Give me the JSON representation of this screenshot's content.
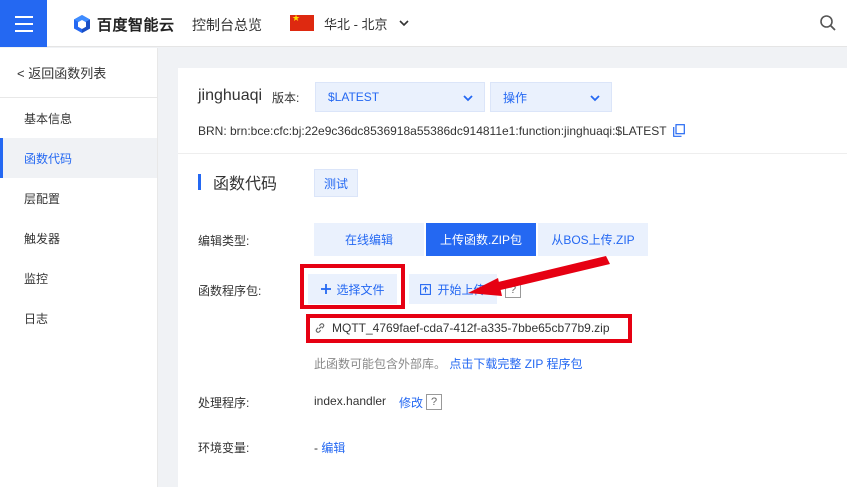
{
  "topbar": {
    "brand": "百度智能云",
    "console_link": "控制台总览",
    "region": "华北 - 北京",
    "icons": [
      "menu-icon",
      "baidu-cloud-logo",
      "china-flag-icon",
      "chevron-down-icon",
      "search-icon"
    ]
  },
  "sidebar": {
    "back": "< 返回函数列表",
    "items": [
      {
        "label": "基本信息"
      },
      {
        "label": "函数代码",
        "active": true
      },
      {
        "label": "层配置"
      },
      {
        "label": "触发器"
      },
      {
        "label": "监控"
      },
      {
        "label": "日志"
      }
    ]
  },
  "main": {
    "function_name": "jinghuaqi",
    "version_label": "版本:",
    "version_value": "$LATEST",
    "action_value": "操作",
    "brn": "BRN:  brn:bce:cfc:bj:22e9c36dc8536918a55386dc914811e1:function:jinghuaqi:$LATEST",
    "section_title": "函数代码",
    "test_button": "测试",
    "edit_type_label": "编辑类型:",
    "edit_types": [
      "在线编辑",
      "上传函数.ZIP包",
      "从BOS上传.ZIP"
    ],
    "edit_type_selected": "上传函数.ZIP包",
    "package_label": "函数程序包:",
    "choose_file": "选择文件",
    "start_upload": "开始上传",
    "help": "?",
    "file_name": "MQTT_4769faef-cda7-412f-a335-7bbe65cb77b9.zip",
    "note_text": "此函数可能包含外部库。",
    "note_link": "点击下载完整 ZIP 程序包",
    "handler_label": "处理程序:",
    "handler_value": "index.handler",
    "modify": "修改",
    "env_label": "环境变量:",
    "env_dash": "-",
    "env_edit": "编辑"
  },
  "colors": {
    "primary": "#2468f2",
    "primary_light": "#eaf1fd",
    "annotation_red": "#e60012"
  }
}
